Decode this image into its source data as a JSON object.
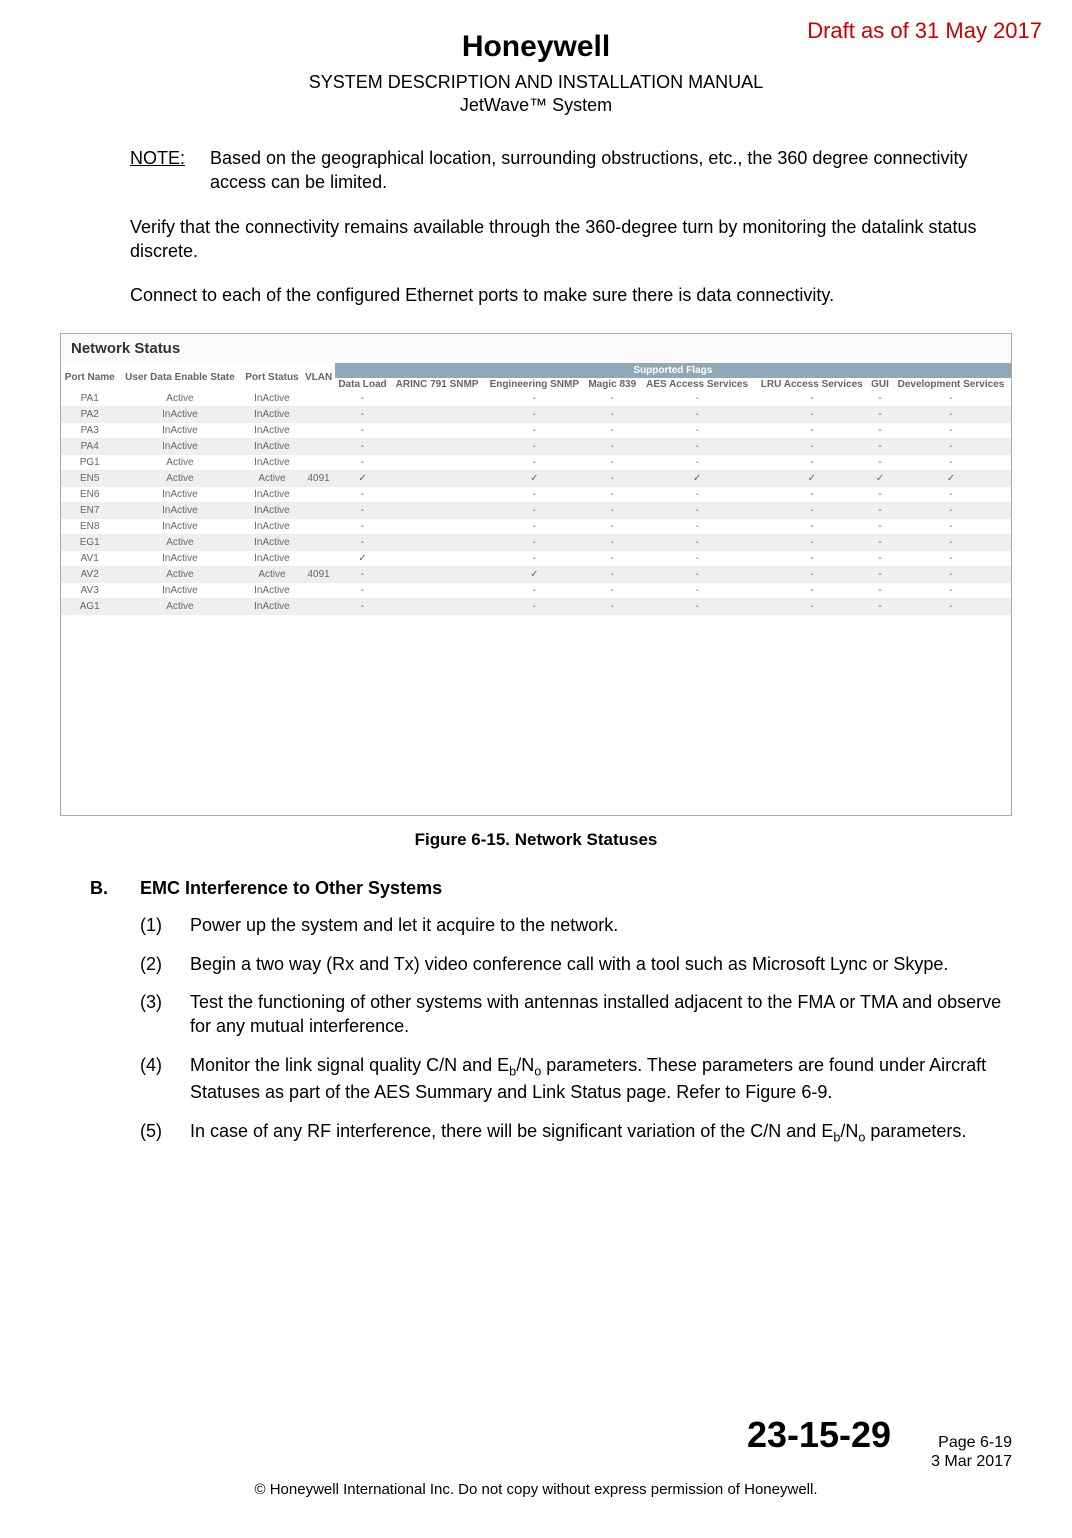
{
  "draft_stamp": "Draft as of 31 May 2017",
  "logo": "Honeywell",
  "doc_title": "SYSTEM DESCRIPTION AND INSTALLATION MANUAL",
  "subtitle": "JetWave™ System",
  "note": {
    "label": "NOTE:",
    "text": "Based on the geographical location, surrounding obstructions, etc., the 360 degree connectivity access can be limited."
  },
  "para1": "Verify that the connectivity remains available through the 360-degree turn by monitoring the datalink status discrete.",
  "para2": "Connect to each of the configured Ethernet ports to make sure there is data connectivity.",
  "network_status": {
    "panel_title": "Network Status",
    "group_header": "Supported Flags",
    "headers": [
      "Port Name",
      "User Data Enable State",
      "Port Status",
      "VLAN",
      "Data Load",
      "ARINC 791 SNMP",
      "Engineering SNMP",
      "Magic 839",
      "AES Access Services",
      "LRU Access Services",
      "GUI",
      "Development Services"
    ],
    "rows": [
      [
        "PA1",
        "Active",
        "InActive",
        "",
        "-",
        "",
        "-",
        "-",
        "-",
        "-",
        "-",
        "-"
      ],
      [
        "PA2",
        "InActive",
        "InActive",
        "",
        "-",
        "",
        "-",
        "-",
        "-",
        "-",
        "-",
        "-"
      ],
      [
        "PA3",
        "InActive",
        "InActive",
        "",
        "-",
        "",
        "-",
        "-",
        "-",
        "-",
        "-",
        "-"
      ],
      [
        "PA4",
        "InActive",
        "InActive",
        "",
        "-",
        "",
        "-",
        "-",
        "-",
        "-",
        "-",
        "-"
      ],
      [
        "PG1",
        "Active",
        "InActive",
        "",
        "-",
        "",
        "-",
        "-",
        "-",
        "-",
        "-",
        "-"
      ],
      [
        "EN5",
        "Active",
        "Active",
        "4091",
        "✓",
        "",
        "✓",
        "-",
        "✓",
        "✓",
        "✓",
        "✓"
      ],
      [
        "EN6",
        "InActive",
        "InActive",
        "",
        "-",
        "",
        "-",
        "-",
        "-",
        "-",
        "-",
        "-"
      ],
      [
        "EN7",
        "InActive",
        "InActive",
        "",
        "-",
        "",
        "-",
        "-",
        "-",
        "-",
        "-",
        "-"
      ],
      [
        "EN8",
        "InActive",
        "InActive",
        "",
        "-",
        "",
        "-",
        "-",
        "-",
        "-",
        "-",
        "-"
      ],
      [
        "EG1",
        "Active",
        "InActive",
        "",
        "-",
        "",
        "-",
        "-",
        "-",
        "-",
        "-",
        "-"
      ],
      [
        "AV1",
        "InActive",
        "InActive",
        "",
        "✓",
        "",
        "-",
        "-",
        "-",
        "-",
        "-",
        "-"
      ],
      [
        "AV2",
        "Active",
        "Active",
        "4091",
        "-",
        "",
        "✓",
        "-",
        "-",
        "-",
        "-",
        "-"
      ],
      [
        "AV3",
        "InActive",
        "InActive",
        "",
        "-",
        "",
        "-",
        "-",
        "-",
        "-",
        "-",
        "-"
      ],
      [
        "AG1",
        "Active",
        "InActive",
        "",
        "-",
        "",
        "-",
        "-",
        "-",
        "-",
        "-",
        "-"
      ]
    ]
  },
  "figure_caption": "Figure 6-15.  Network Statuses",
  "section_b": {
    "letter": "B.",
    "title": "EMC Interference to Other Systems",
    "items": [
      {
        "num": "(1)",
        "text": "Power up the system and let it acquire to the network."
      },
      {
        "num": "(2)",
        "text": "Begin a two way (Rx and Tx) video conference call with a tool such as Microsoft Lync or Skype."
      },
      {
        "num": "(3)",
        "text": "Test the functioning of other systems with antennas installed adjacent to the FMA or TMA and observe for any mutual interference."
      },
      {
        "num": "(4)",
        "text_pre": "Monitor the link signal quality C/N and E",
        "sub1": "b",
        "mid": "/N",
        "sub2": "o",
        "text_post": " parameters. These parameters are found under Aircraft Statuses as part of the AES Summary and Link Status page. Refer to Figure 6-9."
      },
      {
        "num": "(5)",
        "text_pre": "In case of any RF interference, there will be significant variation of the C/N and E",
        "sub1": "b",
        "mid": "/N",
        "sub2": "o",
        "text_post": " parameters."
      }
    ]
  },
  "footer": {
    "doc_number": "23-15-29",
    "page": "Page 6-19",
    "date": "3 Mar 2017",
    "copyright": "© Honeywell International Inc. Do not copy without express permission of Honeywell."
  }
}
